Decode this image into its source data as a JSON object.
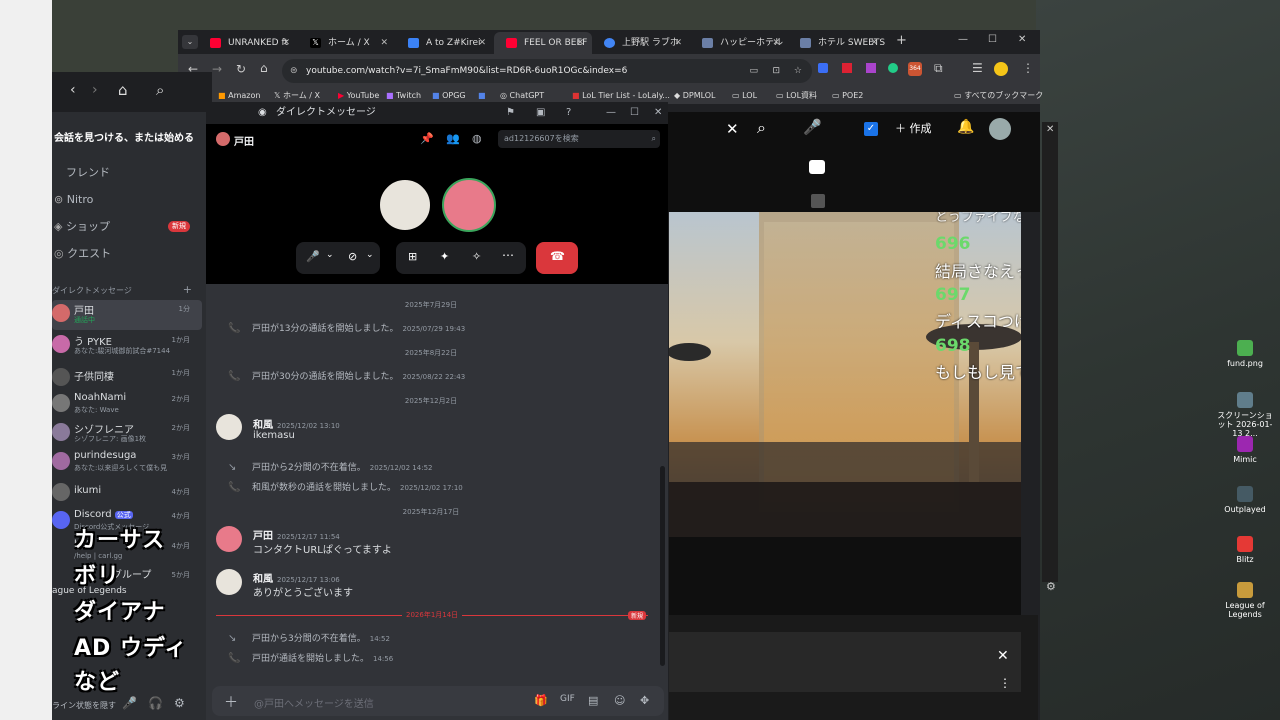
{
  "browser": {
    "tabs": [
      {
        "label": "UNRANKED ft",
        "color": "#ff0033"
      },
      {
        "label": "ホーム / X",
        "color": "#000000"
      },
      {
        "label": "A to Z#Kirei",
        "color": "#3b82f6"
      },
      {
        "label": "FEEL OR BEEF",
        "color": "#ff0033"
      },
      {
        "label": "上野駅 ラブホ",
        "color": "#4285f4"
      },
      {
        "label": "ハッピーホテル",
        "color": "#6b7fa6"
      },
      {
        "label": "ホテル SWEETS",
        "color": "#6b7fa6"
      }
    ],
    "url": "youtube.com/watch?v=7i_SmaFmM90&list=RD6R-6uoR1OGc&index=6",
    "bookmarks": [
      "Amazon",
      "ホーム / X",
      "YouTube",
      "Twitch",
      "OPGG",
      "ChatGPT",
      "LoL Tier List - LoLaly...",
      "DPMLOL",
      "LOL",
      "LOL資料",
      "POE2"
    ],
    "all_bookmarks": "すべてのブックマーク",
    "extension_badge": "364"
  },
  "youtube": {
    "create_label": "作成",
    "chat": [
      {
        "num": "696",
        "text": "結局さなえってちやほやされただけで大した"
      },
      {
        "num": "697",
        "text": "ディスコつけてください"
      },
      {
        "num": "698",
        "text": "もしもし見てない界隈ですか？"
      }
    ],
    "chat_partial": "とうファイブなつは"
  },
  "discord_back": {
    "search": "会話を見つける、または始める",
    "nav": [
      "フレンド",
      "Nitro",
      "ショップ",
      "クエスト"
    ],
    "shop_badge": "新規",
    "dm_header": "ダイレクトメッセージ",
    "dms": [
      {
        "name": "戸田",
        "sub": "通話中",
        "time": "1分",
        "color": "#d46a6a"
      },
      {
        "name": "う PYKE",
        "sub": "あなた:駿河城御前試合#7144",
        "time": "1か月",
        "color": "#c86aa8"
      },
      {
        "name": "子供同棲",
        "sub": "",
        "time": "1か月",
        "color": "#555555"
      },
      {
        "name": "NoahNami",
        "sub": "あなた: Wave",
        "time": "2か月",
        "color": "#777777"
      },
      {
        "name": "シゾフレニア",
        "sub": "シゾフレニア: 画像1枚",
        "time": "2か月",
        "color": "#8a7a9a"
      },
      {
        "name": "purindesuga",
        "sub": "あなた:以来迎ろしくて僕も見",
        "time": "3か月",
        "color": "#a06aa0"
      },
      {
        "name": "ikumi",
        "sub": "",
        "time": "4か月",
        "color": "#666666"
      },
      {
        "name": "Discord",
        "sub": "Discord公式メッセージ",
        "time": "4か月",
        "color": "#5865f2"
      },
      {
        "name": "bot",
        "sub": "/help | carl.gg",
        "time": "4か月",
        "color": "#3a3a3a"
      },
      {
        "name": "グループ",
        "sub": "",
        "time": "5か月",
        "color": "#888888"
      }
    ],
    "official_badge": "公式",
    "overlay_lines": [
      "カーサス",
      "ボリ",
      "ダイアナ",
      "AD ウディ",
      "など"
    ],
    "league_label": "ague of Legends",
    "footer_text": "ライン状態を隠す"
  },
  "popout": {
    "title": "ダイレクトメッセージ",
    "channel": "戸田",
    "search_placeholder": "ad12126607を検索",
    "messages": {
      "day1": "2025年7月29日",
      "sys1": "戸田が13分の通話を開始しました。",
      "sys1_ts": "2025/07/29 19:43",
      "day2": "2025年8月22日",
      "sys2": "戸田が30分の通話を開始しました。",
      "sys2_ts": "2025/08/22 22:43",
      "day3": "2025年12月2日",
      "m1_author": "和風",
      "m1_ts": "2025/12/02 13:10",
      "m1_body": "ikemasu",
      "sys3": "戸田から2分間の不在着信。",
      "sys3_ts": "2025/12/02 14:52",
      "sys4": "和風が数秒の通話を開始しました。",
      "sys4_ts": "2025/12/02 17:10",
      "day4": "2025年12月17日",
      "m2_author": "戸田",
      "m2_ts": "2025/12/17 11:54",
      "m2_body": "コンタクトURLぱぐってますよ",
      "m3_author": "和風",
      "m3_ts": "2025/12/17 13:06",
      "m3_body": "ありがとうございます",
      "day5": "2026年1月14日",
      "new_badge": "新規",
      "sys5": "戸田から3分間の不在着信。",
      "sys5_ts": "14:52",
      "sys6": "戸田が通話を開始しました。",
      "sys6_ts": "14:56"
    },
    "composer_placeholder": "@戸田へメッセージを送信"
  },
  "desktop": {
    "icons": [
      {
        "label": "fund.png",
        "color": "#4caf50"
      },
      {
        "label": "スクリーンショット 2026-01-13 2...",
        "color": "#607d8b"
      },
      {
        "label": "Mimic",
        "color": "#9c27b0"
      },
      {
        "label": "Outplayed",
        "color": "#455a64"
      },
      {
        "label": "Blitz",
        "color": "#e53935"
      },
      {
        "label": "League of Legends",
        "color": "#c89b3c"
      }
    ]
  }
}
